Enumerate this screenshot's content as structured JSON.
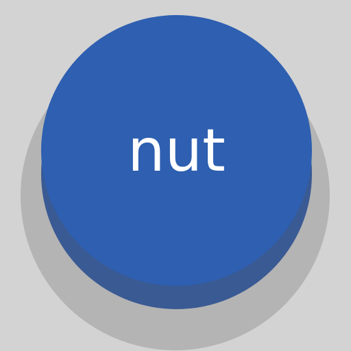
{
  "button": {
    "label": "nut"
  },
  "colors": {
    "background": "#d3d3d3",
    "shadow": "#b4b4b4",
    "button_face": "#2e5fb0",
    "button_side": "#3a5a94",
    "label": "#ffffff"
  }
}
